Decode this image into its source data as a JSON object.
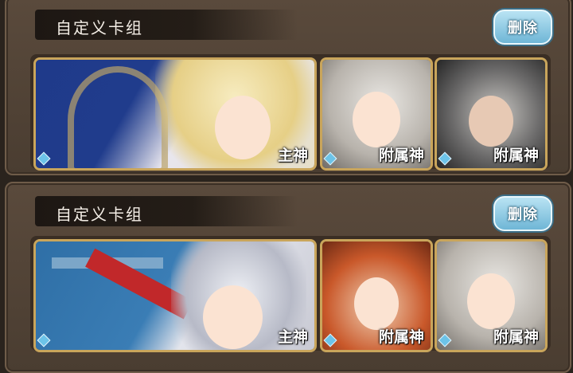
{
  "decks": [
    {
      "title": "自定义卡组",
      "delete_label": "删除",
      "cards": [
        {
          "role": "主神"
        },
        {
          "role": "附属神"
        },
        {
          "role": "附属神"
        }
      ]
    },
    {
      "title": "自定义卡组",
      "delete_label": "删除",
      "cards": [
        {
          "role": "主神"
        },
        {
          "role": "附属神"
        },
        {
          "role": "附属神"
        }
      ]
    }
  ],
  "colors": {
    "panel": "#4a3d31",
    "card_border": "#c9a55b",
    "delete_button": "#6fb6d6"
  }
}
